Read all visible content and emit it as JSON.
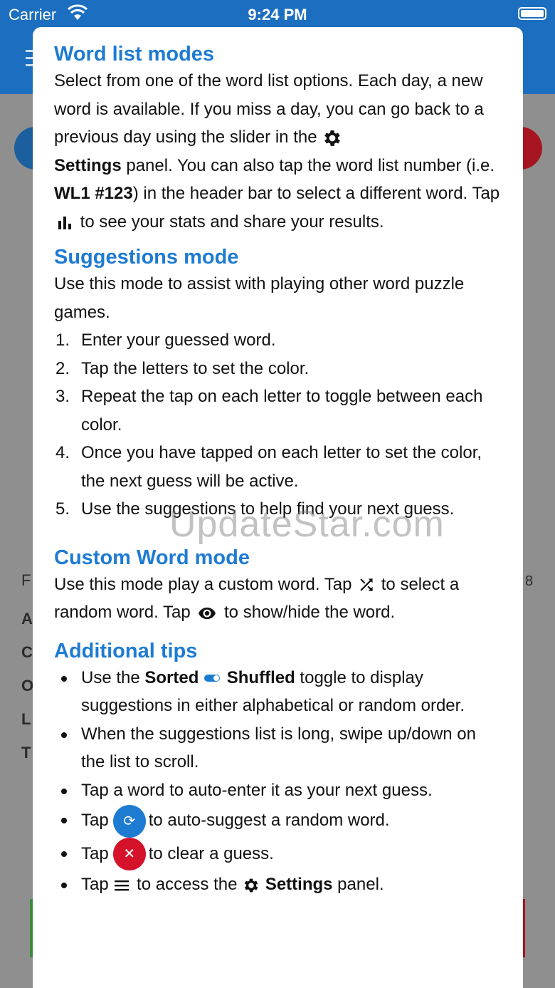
{
  "status_bar": {
    "carrier": "Carrier",
    "time": "9:24 PM"
  },
  "background": {
    "first_letter": "F",
    "letters": [
      "A",
      "C",
      "O",
      "L",
      "T"
    ],
    "right_number": "8"
  },
  "help": {
    "word_list": {
      "heading": "Word list modes",
      "text_1": "Select from one of the word list options. Each day, a new word is available. If you miss a day, you can go back to a previous day using the slider in the",
      "settings_bold": "Settings",
      "text_2": "panel. You can also tap the word list number (i.e.",
      "example_bold": "WL1 #123",
      "text_3": ") in the header bar to select a different word. Tap",
      "text_4": "to see your stats and share your results."
    },
    "suggestions": {
      "heading": "Suggestions mode",
      "intro": "Use this mode to assist with playing other word puzzle games.",
      "steps": [
        {
          "n": "1.",
          "text": "Enter your guessed word."
        },
        {
          "n": "2.",
          "text": "Tap the letters to set the color."
        },
        {
          "n": "3.",
          "text": "Repeat the tap on each letter to toggle between each color."
        },
        {
          "n": "4.",
          "text": "Once you have tapped on each letter to set the color, the next guess will be active."
        },
        {
          "n": "5.",
          "text": "Use the suggestions to help find your next guess."
        }
      ]
    },
    "custom": {
      "heading": "Custom Word mode",
      "text_1": "Use this mode play a custom word. Tap",
      "text_2": "to select a random word. Tap",
      "text_3": "to show/hide the word."
    },
    "tips": {
      "heading": "Additional tips",
      "t1_a": "Use the",
      "t1_sorted": "Sorted",
      "t1_shuffled": "Shuffled",
      "t1_b": "toggle to display suggestions in either alphabetical or random order.",
      "t2": "When the suggestions list is long, swipe up/down on the list to scroll.",
      "t3": "Tap a word to auto-enter it as your next guess.",
      "t4_a": "Tap",
      "t4_b": "to auto-suggest a random word.",
      "t5_a": "Tap",
      "t5_b": "to clear a guess.",
      "t6_a": "Tap",
      "t6_b": "to access the",
      "t6_settings": "Settings",
      "t6_c": "panel."
    }
  },
  "watermark": "UpdateStar.com",
  "icons": [
    "wifi-icon",
    "battery-icon",
    "menu-icon",
    "gear-icon",
    "stats-icon",
    "shuffle-icon",
    "eye-icon",
    "toggle-icon",
    "refresh-icon",
    "close-icon"
  ],
  "colors": {
    "accent": "#1e7bd2",
    "header": "#1c6fc0",
    "danger": "#d4122a"
  }
}
